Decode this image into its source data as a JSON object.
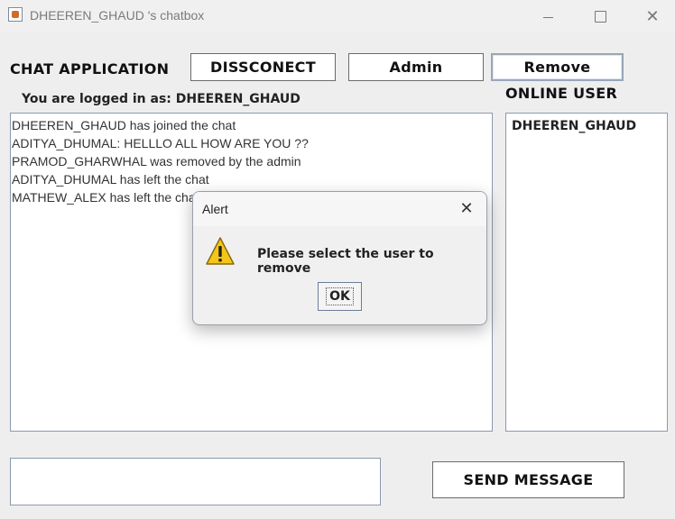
{
  "window": {
    "title": "DHEEREN_GHAUD 's chatbox",
    "minimize_icon": "minimize-icon",
    "maximize_icon": "maximize-icon",
    "close_icon": "close-icon"
  },
  "header": {
    "app_title": "CHAT APPLICATION",
    "disconnect_label": "DISSCONECT",
    "admin_label": "Admin",
    "remove_label": "Remove"
  },
  "status": {
    "logged_in_text": "You are logged in as: DHEEREN_GHAUD"
  },
  "online": {
    "title": "ONLINE USER",
    "users": [
      "DHEEREN_GHAUD"
    ]
  },
  "chat": {
    "messages": [
      "DHEEREN_GHAUD has joined the chat",
      "ADITYA_DHUMAL: HELLLO ALL HOW ARE YOU ??",
      "PRAMOD_GHARWHAL was removed by the admin",
      "ADITYA_DHUMAL has left the chat",
      "MATHEW_ALEX has left the chat"
    ]
  },
  "composer": {
    "input_value": "",
    "send_label": "SEND MESSAGE"
  },
  "dialog": {
    "title": "Alert",
    "message": "Please select the user to remove",
    "ok_label": "OK",
    "icon": "warning-icon"
  },
  "colors": {
    "border": "#8a9aae",
    "background": "#eeeeee",
    "warning": "#f5c518"
  }
}
